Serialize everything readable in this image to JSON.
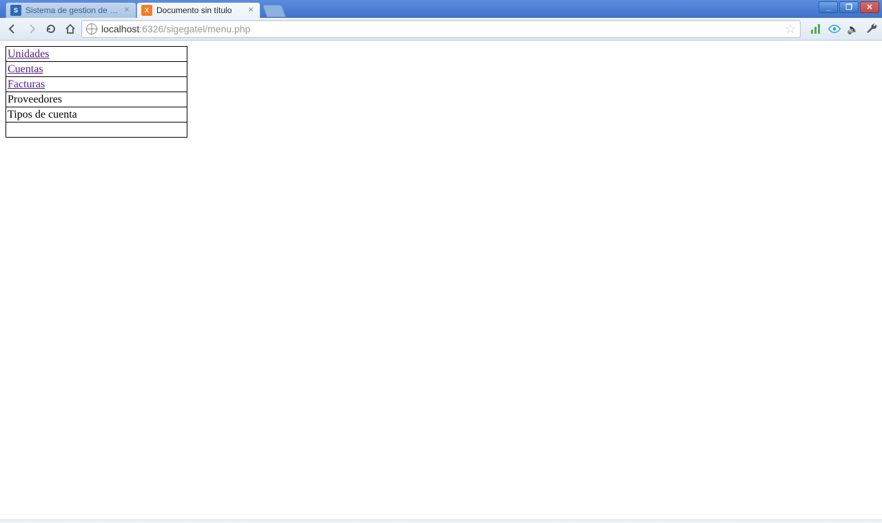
{
  "window_controls": {
    "min": "_",
    "max": "❐",
    "close": "✕"
  },
  "tabs": [
    {
      "title": "Sistema de gestion de gastos",
      "favicon": "sigegatel",
      "favicon_text": "S",
      "active": false
    },
    {
      "title": "Documento sin título",
      "favicon": "xampp",
      "favicon_text": "X",
      "active": true
    }
  ],
  "address": {
    "scheme_host": "localhost",
    "rest": ":6326/sigegatel/menu.php"
  },
  "menu_items": [
    {
      "label": "Unidades",
      "is_link": true
    },
    {
      "label": "Cuentas",
      "is_link": true
    },
    {
      "label": "Facturas",
      "is_link": true
    },
    {
      "label": "Proveedores",
      "is_link": false
    },
    {
      "label": "Tipos de cuenta",
      "is_link": false
    },
    {
      "label": "",
      "is_link": false
    }
  ]
}
